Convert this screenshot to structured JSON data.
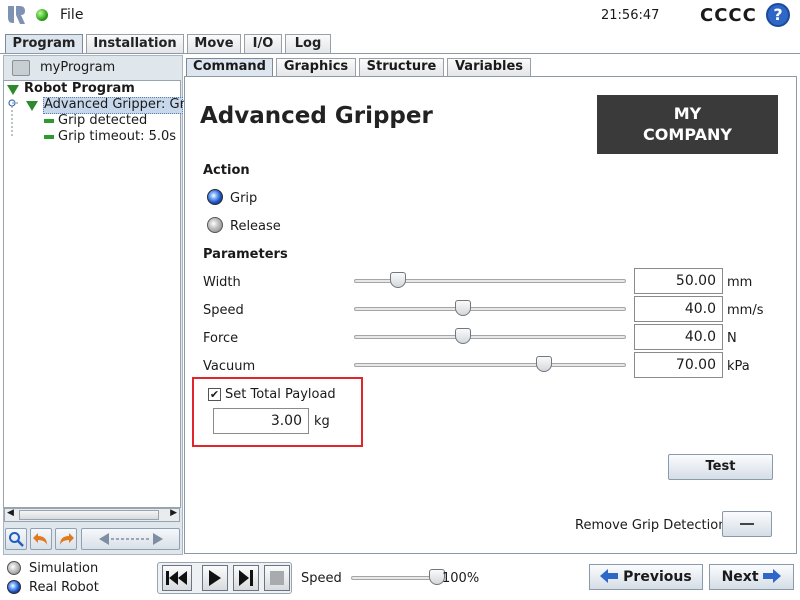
{
  "topbar": {
    "file_label": "File",
    "clock": "21:56:47",
    "robot_name": "CCCC",
    "help_glyph": "?"
  },
  "main_tabs": [
    {
      "label": "Program",
      "active": true
    },
    {
      "label": "Installation",
      "active": false
    },
    {
      "label": "Move",
      "active": false
    },
    {
      "label": "I/O",
      "active": false
    },
    {
      "label": "Log",
      "active": false
    }
  ],
  "left": {
    "program_name": "myProgram",
    "tree": {
      "root": "Robot Program",
      "node": "Advanced Gripper: Gri",
      "children": [
        "Grip detected",
        "Grip timeout: 5.0s"
      ]
    },
    "tools": {
      "search_icon": "search-icon",
      "undo_icon": "undo-icon",
      "redo_icon": "redo-icon",
      "move_icon": "move-arrows-icon"
    }
  },
  "sub_tabs": [
    {
      "label": "Command",
      "active": true
    },
    {
      "label": "Graphics",
      "active": false
    },
    {
      "label": "Structure",
      "active": false
    },
    {
      "label": "Variables",
      "active": false
    }
  ],
  "content": {
    "title": "Advanced Gripper",
    "company_line1": "MY",
    "company_line2": "COMPANY",
    "action": {
      "heading": "Action",
      "options": [
        {
          "label": "Grip",
          "selected": true
        },
        {
          "label": "Release",
          "selected": false
        }
      ]
    },
    "parameters": {
      "heading": "Parameters",
      "rows": [
        {
          "label": "Width",
          "value": "50.00",
          "unit": "mm",
          "level": 0.16
        },
        {
          "label": "Speed",
          "value": "40.0",
          "unit": "mm/s",
          "level": 0.4
        },
        {
          "label": "Force",
          "value": "40.0",
          "unit": "N",
          "level": 0.4
        },
        {
          "label": "Vacuum",
          "value": "70.00",
          "unit": "kPa",
          "level": 0.7
        }
      ]
    },
    "payload": {
      "checked": true,
      "label": "Set Total Payload",
      "value": "3.00",
      "unit": "kg"
    },
    "test_label": "Test",
    "remove_grip_label": "Remove Grip Detection"
  },
  "bottom": {
    "simulation_label": "Simulation",
    "real_robot_label": "Real Robot",
    "speed_label": "Speed",
    "speed_value": "100%",
    "speed_level": 1.0,
    "previous_label": "Previous",
    "next_label": "Next"
  },
  "colors": {
    "accent": "#2f67c8",
    "highlight": "#e0262b",
    "tree_green": "#2c8a2c",
    "company_bg": "#3a3a3a"
  }
}
